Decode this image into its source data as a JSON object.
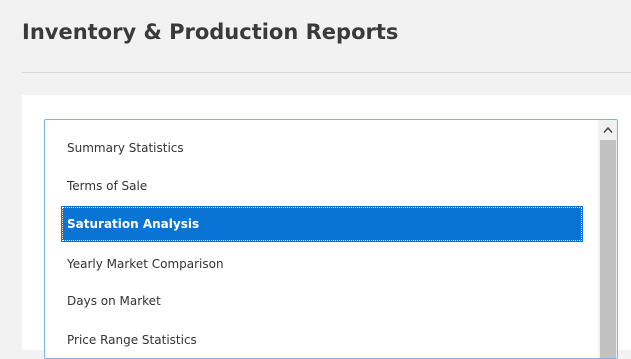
{
  "header": {
    "title": "Inventory & Production Reports"
  },
  "report_list": {
    "items": [
      {
        "label": "Summary Statistics",
        "selected": false
      },
      {
        "label": "Terms of Sale",
        "selected": false
      },
      {
        "label": "Saturation Analysis",
        "selected": true
      },
      {
        "label": "Yearly Market Comparison",
        "selected": false
      },
      {
        "label": "Days on Market",
        "selected": false
      },
      {
        "label": "Price Range Statistics",
        "selected": false
      }
    ],
    "selected_color": "#0a74d4"
  },
  "scrollbar": {
    "up_icon": "chevron-up-icon"
  }
}
